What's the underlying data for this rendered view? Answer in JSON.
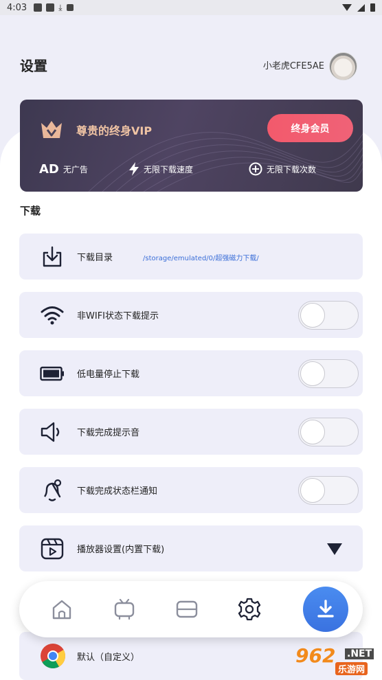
{
  "status_bar": {
    "time": "4:03"
  },
  "header": {
    "title": "设置",
    "username": "小老虎CFE5AE"
  },
  "vip": {
    "title": "尊贵的终身VIP",
    "button_label": "终身会员",
    "features": [
      {
        "icon": "AD",
        "label": "无广告"
      },
      {
        "icon": "lightning-icon",
        "label": "无限下载速度"
      },
      {
        "icon": "plus-circle-icon",
        "label": "无限下载次数"
      }
    ],
    "accent_color": "#f25a6c",
    "title_color": "#f0c4a4"
  },
  "download_section": {
    "title": "下载",
    "rows": [
      {
        "label": "下载目录",
        "path": "/storage/emulated/0/超强磁力下载/",
        "icon": "download-icon"
      },
      {
        "label": "非WIFI状态下载提示",
        "icon": "wifi-icon",
        "toggle": false
      },
      {
        "label": "低电量停止下载",
        "icon": "battery-icon",
        "toggle": false
      },
      {
        "label": "下载完成提示音",
        "icon": "speaker-icon",
        "toggle": false
      },
      {
        "label": "下载完成状态栏通知",
        "icon": "bell-icon",
        "toggle": false
      },
      {
        "label": "播放器设置(内置下载)",
        "icon": "player-icon",
        "expand": "caret-down-icon"
      }
    ]
  },
  "player_option": {
    "label": "默认（自定义）",
    "icon": "chrome-icon"
  },
  "bottom_nav": {
    "items": [
      "home-icon",
      "tv-icon",
      "card-icon",
      "gear-icon"
    ],
    "fab": "download-icon",
    "fab_color": "#3a72e0"
  },
  "watermark": {
    "number": "962",
    "net": ".NET",
    "sub": "乐游网"
  }
}
